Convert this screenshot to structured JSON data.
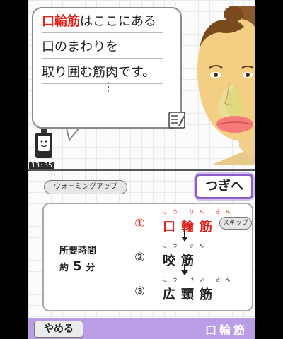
{
  "top": {
    "message": {
      "line1_highlight": "口輪筋",
      "line1_rest": "はここにある",
      "line2": "口のまわりを",
      "line3": "取り囲む筋肉です。",
      "continue_marker": "⋮"
    },
    "clock": "13:35",
    "icons": [
      "memo-icon",
      "clock-character-icon",
      "face-illustration"
    ]
  },
  "bottom": {
    "warmup_label": "ウォーミングアップ",
    "next_label": "つぎへ",
    "duration_label": "所要時間",
    "duration_prefix": "約",
    "duration_value": "5",
    "duration_unit": "分",
    "skip_label": "スキップ",
    "muscles": [
      {
        "index": "①",
        "name": "口輪筋",
        "reading": "こう りん きん",
        "active": true
      },
      {
        "index": "②",
        "name": "咬筋",
        "reading": "こう きん",
        "active": false
      },
      {
        "index": "③",
        "name": "広頸筋",
        "reading": "こう けい きん",
        "active": false
      }
    ],
    "quit_label": "やめる",
    "current_title": "口輪筋"
  },
  "colors": {
    "highlight": "#e0231c",
    "accent_purple": "#b99ee6",
    "next_border": "#8a5fc8"
  }
}
